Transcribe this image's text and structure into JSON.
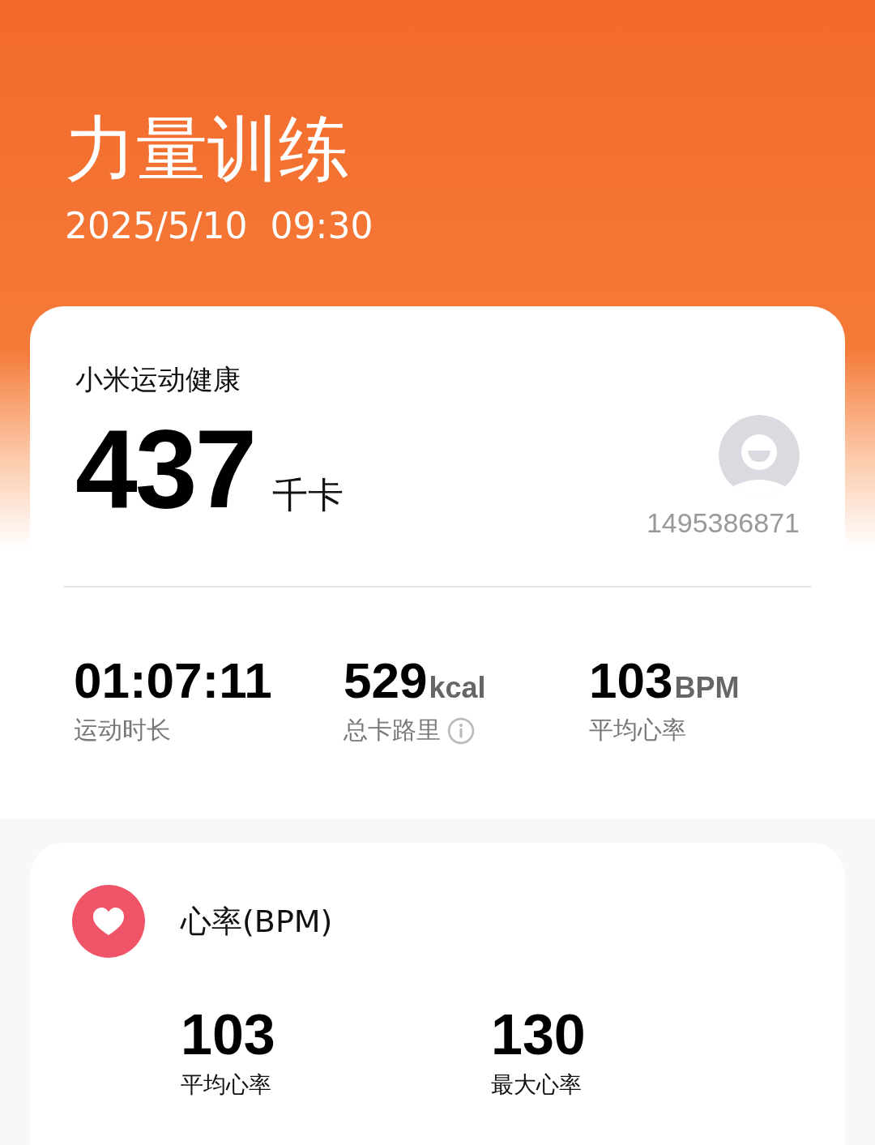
{
  "header": {
    "title": "力量训练",
    "datetime": "2025/5/10  09:30"
  },
  "summary": {
    "source": "小米运动健康",
    "value": "437",
    "unit": "千卡",
    "user_id": "1495386871",
    "stats": [
      {
        "value": "01:07:11",
        "label": "运动时长",
        "info": false
      },
      {
        "value": "529",
        "unit": "kcal",
        "label": "总卡路里",
        "info": true
      },
      {
        "value": "103",
        "unit": "BPM",
        "label": "平均心率",
        "info": false
      }
    ]
  },
  "heart_rate": {
    "title": "心率(BPM)",
    "metrics": [
      {
        "value": "103",
        "label": "平均心率"
      },
      {
        "value": "130",
        "label": "最大心率"
      }
    ]
  }
}
